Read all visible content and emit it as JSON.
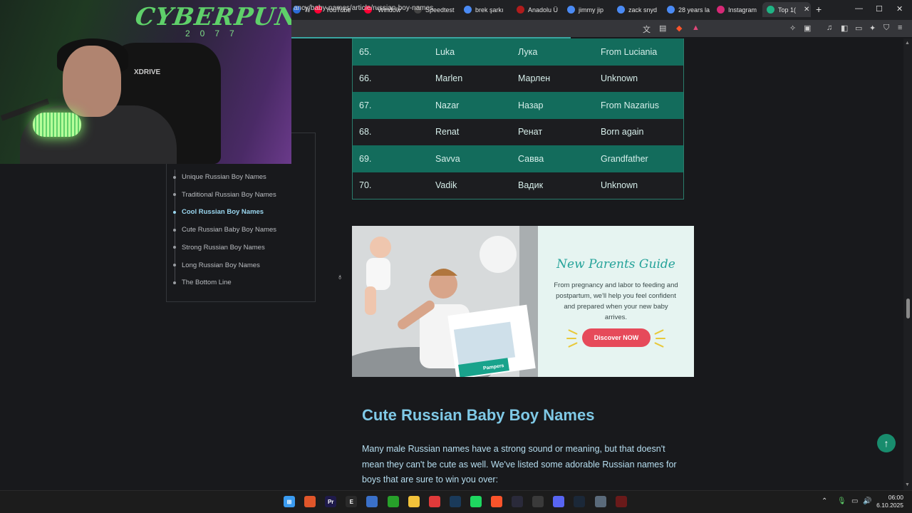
{
  "browser": {
    "tabs": [
      {
        "label": "Tar",
        "color": "#2b6bd6"
      },
      {
        "label": "YouTube",
        "color": "#ff0033"
      },
      {
        "label": "\"Window",
        "color": "#ff0033"
      },
      {
        "label": "Speedtest",
        "color": "#444"
      },
      {
        "label": "brek şarkı",
        "color": "#4a8af4"
      },
      {
        "label": "Anadolu Ü",
        "color": "#b01c1c"
      },
      {
        "label": "jimmy jip",
        "color": "#4a8af4"
      },
      {
        "label": "zack snyd",
        "color": "#4a8af4"
      },
      {
        "label": "28 years la",
        "color": "#4a8af4"
      },
      {
        "label": "Instagram",
        "color": "#d62976"
      },
      {
        "label": "Top 1(",
        "color": "#1fb384",
        "active": true
      }
    ],
    "new_tab": "+",
    "window_controls": {
      "minimize": "—",
      "maximize": "☐",
      "close": "✕"
    },
    "url": "ancy/baby-names/article/russian-boy-names"
  },
  "table": {
    "rows": [
      {
        "num": "65.",
        "name": "Luka",
        "cyrillic": "Лука",
        "meaning": "From Luciania",
        "style": "teal"
      },
      {
        "num": "66.",
        "name": "Marlen",
        "cyrillic": "Марлен",
        "meaning": "Unknown",
        "style": "dark"
      },
      {
        "num": "67.",
        "name": "Nazar",
        "cyrillic": "Назар",
        "meaning": "From Nazarius",
        "style": "teal"
      },
      {
        "num": "68.",
        "name": "Renat",
        "cyrillic": "Ренат",
        "meaning": "Born again",
        "style": "dark"
      },
      {
        "num": "69.",
        "name": "Savva",
        "cyrillic": "Савва",
        "meaning": "Grandfather",
        "style": "teal"
      },
      {
        "num": "70.",
        "name": "Vadik",
        "cyrillic": "Вадик",
        "meaning": "Unknown",
        "style": "dark"
      }
    ]
  },
  "toc": {
    "items": [
      {
        "label": "Unique Russian Boy Names"
      },
      {
        "label": "Traditional Russian Boy Names"
      },
      {
        "label": "Cool Russian Boy Names",
        "active": true
      },
      {
        "label": "Cute Russian Baby Boy Names"
      },
      {
        "label": "Strong Russian Boy Names"
      },
      {
        "label": "Long Russian Boy Names"
      },
      {
        "label": "The Bottom Line"
      }
    ]
  },
  "ad": {
    "title": "New Parents Guide",
    "text": "From pregnancy and labor to feeding and postpartum, we'll help you feel confident and prepared when your new baby arrives.",
    "button": "Discover NOW",
    "book_label": "Pampers"
  },
  "article": {
    "heading": "Cute Russian Baby Boy Names",
    "paragraph": "Many male Russian names have a strong sound or meaning, but that doesn't mean they can't be cute as well. We've listed some adorable Russian names for boys that are sure to win you over:"
  },
  "webcam": {
    "poster_title": "CYBERPUNK",
    "poster_year": "2077",
    "chair_label": "XDRIVE"
  },
  "taskbar": {
    "apps": [
      {
        "name": "windows-start",
        "color": "#3a9bf0",
        "glyph": "⊞"
      },
      {
        "name": "firefox",
        "color": "#e0562a",
        "glyph": ""
      },
      {
        "name": "premiere",
        "color": "#1f1a4a",
        "glyph": "Pr"
      },
      {
        "name": "epic-games",
        "color": "#2a2a2a",
        "glyph": "E"
      },
      {
        "name": "remote-desktop",
        "color": "#3a70c9",
        "glyph": ""
      },
      {
        "name": "xbox",
        "color": "#27a02a",
        "glyph": ""
      },
      {
        "name": "file-explorer",
        "color": "#f2c23a",
        "glyph": ""
      },
      {
        "name": "chat-app",
        "color": "#e03a3a",
        "glyph": ""
      },
      {
        "name": "steam-alt",
        "color": "#1a3a5a",
        "glyph": ""
      },
      {
        "name": "spotify",
        "color": "#1ed760",
        "glyph": ""
      },
      {
        "name": "brave",
        "color": "#fb542b",
        "glyph": ""
      },
      {
        "name": "obs",
        "color": "#2a2a3a",
        "glyph": ""
      },
      {
        "name": "clock-app",
        "color": "#3a3a3a",
        "glyph": ""
      },
      {
        "name": "discord",
        "color": "#5865f2",
        "glyph": ""
      },
      {
        "name": "steam",
        "color": "#1b2838",
        "glyph": ""
      },
      {
        "name": "settings",
        "color": "#5a6a7a",
        "glyph": ""
      },
      {
        "name": "game-app",
        "color": "#6a1a1a",
        "glyph": ""
      }
    ],
    "time": "06:00",
    "date": "6.10.2025"
  }
}
